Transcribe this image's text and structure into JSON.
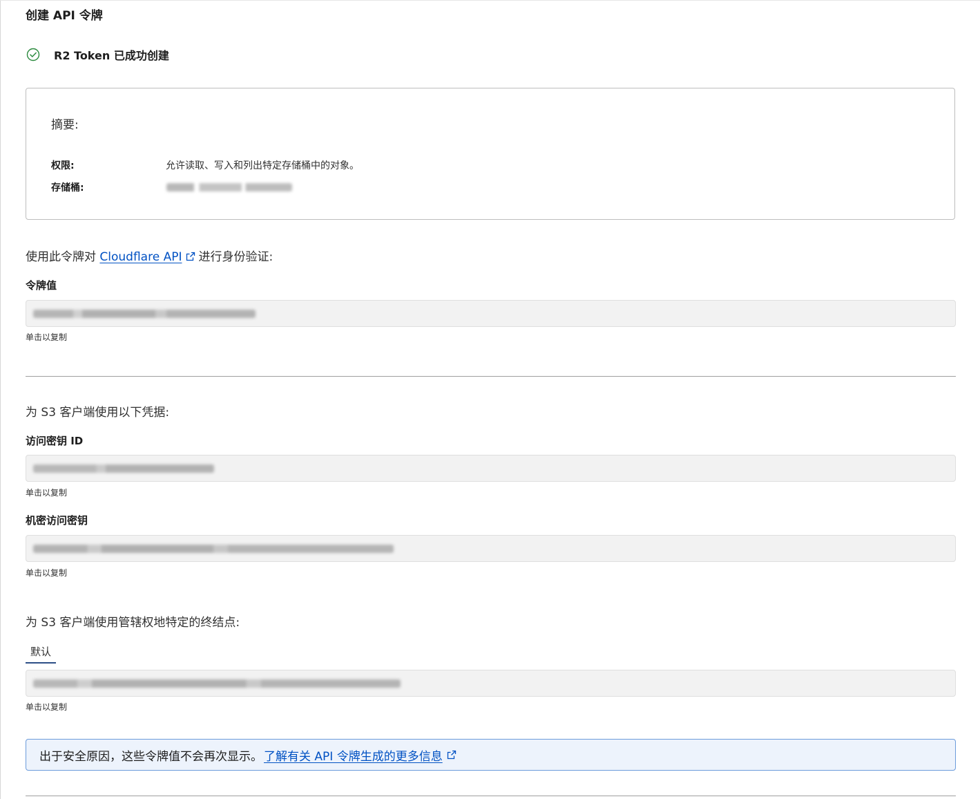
{
  "page": {
    "title": "创建 API 令牌"
  },
  "success": {
    "message": "R2 Token 已成功创建",
    "icon": "check-circle-icon",
    "color": "#2b8a3e"
  },
  "summary": {
    "heading": "摘要:",
    "permissions_label": "权限:",
    "permissions_value": "允许读取、写入和列出特定存储桶中的对象。",
    "bucket_label": "存储桶:"
  },
  "api_section": {
    "prefix": "使用此令牌对",
    "link": "Cloudflare API",
    "suffix": "进行身份验证:"
  },
  "token_value": {
    "label": "令牌值",
    "hint": "单击以复制"
  },
  "s3_section": {
    "heading": "为 S3 客户端使用以下凭据:"
  },
  "access_key_id": {
    "label": "访问密钥 ID",
    "hint": "单击以复制"
  },
  "secret_access_key": {
    "label": "机密访问密钥",
    "hint": "单击以复制"
  },
  "endpoint_section": {
    "heading": "为 S3 客户端使用管辖权地特定的终结点:",
    "tab": "默认",
    "hint": "单击以复制"
  },
  "notice": {
    "text": "出于安全原因，这些令牌值不会再次显示。",
    "link": "了解有关 API 令牌生成的更多信息"
  },
  "colors": {
    "link": "#0051c3",
    "notice_bg": "#edf3fc",
    "notice_border": "#6b9bdb",
    "tab_underline": "#2c4e86"
  }
}
